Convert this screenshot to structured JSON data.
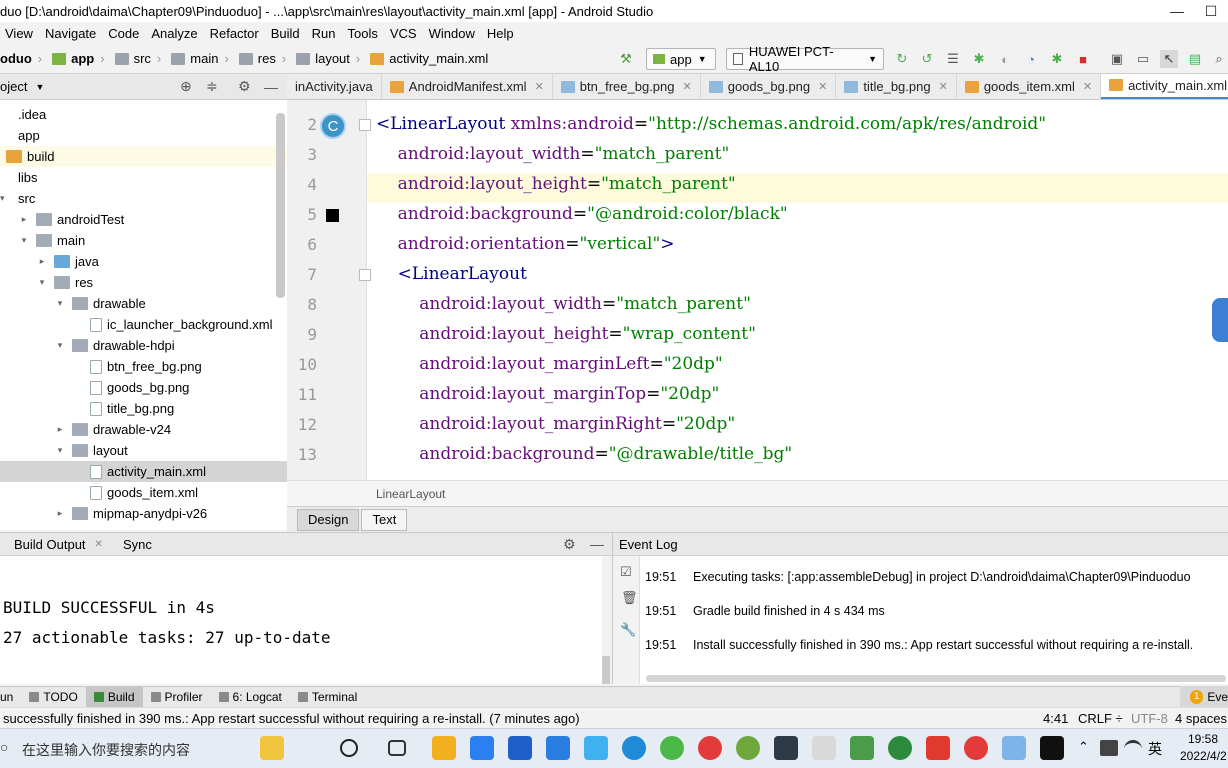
{
  "window": {
    "title": "duo [D:\\android\\daima\\Chapter09\\Pinduoduo] - ...\\app\\src\\main\\res\\layout\\activity_main.xml [app] - Android Studio",
    "minimize": "—",
    "maximize": "☐",
    "close": "✕"
  },
  "menu": {
    "items": [
      "View",
      "Navigate",
      "Code",
      "Analyze",
      "Refactor",
      "Build",
      "Run",
      "Tools",
      "VCS",
      "Window",
      "Help"
    ]
  },
  "breadcrumb": {
    "items": [
      "oduo",
      "app",
      "src",
      "main",
      "res",
      "layout",
      "activity_main.xml"
    ]
  },
  "toolbar": {
    "run_config": "app",
    "device": "HUAWEI PCT-AL10"
  },
  "project_panel": {
    "title": "oject",
    "tree": [
      {
        "label": ".idea",
        "depth": 0,
        "arrow": "",
        "kind": "folder"
      },
      {
        "label": "app",
        "depth": 0,
        "arrow": "",
        "kind": "folder"
      },
      {
        "label": "build",
        "depth": 0,
        "arrow": "",
        "kind": "folder-orange"
      },
      {
        "label": "libs",
        "depth": 0,
        "arrow": "",
        "kind": "folder"
      },
      {
        "label": "src",
        "depth": 0,
        "arrow": "▾",
        "kind": "folder"
      },
      {
        "label": "androidTest",
        "depth": 1,
        "arrow": "▸",
        "kind": "folder"
      },
      {
        "label": "main",
        "depth": 1,
        "arrow": "▾",
        "kind": "folder"
      },
      {
        "label": "java",
        "depth": 2,
        "arrow": "▸",
        "kind": "folder-blue"
      },
      {
        "label": "res",
        "depth": 2,
        "arrow": "▾",
        "kind": "folder"
      },
      {
        "label": "drawable",
        "depth": 3,
        "arrow": "▾",
        "kind": "folder"
      },
      {
        "label": "ic_launcher_background.xml",
        "depth": 4,
        "arrow": "",
        "kind": "file"
      },
      {
        "label": "drawable-hdpi",
        "depth": 3,
        "arrow": "▾",
        "kind": "folder"
      },
      {
        "label": "btn_free_bg.png",
        "depth": 4,
        "arrow": "",
        "kind": "file"
      },
      {
        "label": "goods_bg.png",
        "depth": 4,
        "arrow": "",
        "kind": "file"
      },
      {
        "label": "title_bg.png",
        "depth": 4,
        "arrow": "",
        "kind": "file"
      },
      {
        "label": "drawable-v24",
        "depth": 3,
        "arrow": "▸",
        "kind": "folder"
      },
      {
        "label": "layout",
        "depth": 3,
        "arrow": "▾",
        "kind": "folder"
      },
      {
        "label": "activity_main.xml",
        "depth": 4,
        "arrow": "",
        "kind": "file",
        "selected": true
      },
      {
        "label": "goods_item.xml",
        "depth": 4,
        "arrow": "",
        "kind": "file"
      },
      {
        "label": "mipmap-anydpi-v26",
        "depth": 3,
        "arrow": "▸",
        "kind": "folder"
      }
    ]
  },
  "editor_tabs": [
    {
      "label": "inActivity.java",
      "active": false
    },
    {
      "label": "AndroidManifest.xml",
      "active": false
    },
    {
      "label": "btn_free_bg.png",
      "active": false
    },
    {
      "label": "goods_bg.png",
      "active": false
    },
    {
      "label": "title_bg.png",
      "active": false
    },
    {
      "label": "goods_item.xml",
      "active": false
    },
    {
      "label": "activity_main.xml",
      "active": true
    }
  ],
  "editor": {
    "lines": [
      {
        "n": "2",
        "parts": [
          [
            "t",
            "<LinearLayout "
          ],
          [
            "a",
            "xmlns:android"
          ],
          [
            "p",
            "="
          ],
          [
            "v",
            "\"http://schemas.android.com/apk/res/android\""
          ]
        ]
      },
      {
        "n": "3",
        "parts": [
          [
            "p",
            "    "
          ],
          [
            "a",
            "android:layout_width"
          ],
          [
            "p",
            "="
          ],
          [
            "v",
            "\"match_parent\""
          ]
        ]
      },
      {
        "n": "4",
        "parts": [
          [
            "p",
            "    "
          ],
          [
            "a",
            "android:layout_height"
          ],
          [
            "p",
            "="
          ],
          [
            "v",
            "\"match_parent\""
          ]
        ]
      },
      {
        "n": "5",
        "parts": [
          [
            "p",
            "    "
          ],
          [
            "a",
            "android:background"
          ],
          [
            "p",
            "="
          ],
          [
            "v",
            "\"@android:color/black\""
          ]
        ]
      },
      {
        "n": "6",
        "parts": [
          [
            "p",
            "    "
          ],
          [
            "a",
            "android:orientation"
          ],
          [
            "p",
            "="
          ],
          [
            "v",
            "\"vertical\""
          ],
          [
            "t",
            ">"
          ]
        ]
      },
      {
        "n": "7",
        "parts": [
          [
            "p",
            "    "
          ],
          [
            "t",
            "<LinearLayout"
          ]
        ]
      },
      {
        "n": "8",
        "parts": [
          [
            "p",
            "        "
          ],
          [
            "a",
            "android:layout_width"
          ],
          [
            "p",
            "="
          ],
          [
            "v",
            "\"match_parent\""
          ]
        ]
      },
      {
        "n": "9",
        "parts": [
          [
            "p",
            "        "
          ],
          [
            "a",
            "android:layout_height"
          ],
          [
            "p",
            "="
          ],
          [
            "v",
            "\"wrap_content\""
          ]
        ]
      },
      {
        "n": "10",
        "parts": [
          [
            "p",
            "        "
          ],
          [
            "a",
            "android:layout_marginLeft"
          ],
          [
            "p",
            "="
          ],
          [
            "v",
            "\"20dp\""
          ]
        ]
      },
      {
        "n": "11",
        "parts": [
          [
            "p",
            "        "
          ],
          [
            "a",
            "android:layout_marginTop"
          ],
          [
            "p",
            "="
          ],
          [
            "v",
            "\"20dp\""
          ]
        ]
      },
      {
        "n": "12",
        "parts": [
          [
            "p",
            "        "
          ],
          [
            "a",
            "android:layout_marginRight"
          ],
          [
            "p",
            "="
          ],
          [
            "v",
            "\"20dp\""
          ]
        ]
      },
      {
        "n": "13",
        "parts": [
          [
            "p",
            "        "
          ],
          [
            "a",
            "android:background"
          ],
          [
            "p",
            "="
          ],
          [
            "v",
            "\"@drawable/title_bg\""
          ]
        ]
      }
    ],
    "class_badge": "C",
    "structure_crumb": "LinearLayout"
  },
  "design_tabs": [
    "Design",
    "Text"
  ],
  "build_panel": {
    "tabs": [
      "Build Output",
      "Sync"
    ],
    "lines": [
      "BUILD SUCCESSFUL in 4s",
      "27 actionable tasks: 27 up-to-date"
    ]
  },
  "event_log": {
    "title": "Event Log",
    "entries": [
      {
        "time": "19:51",
        "text": "Executing tasks: [:app:assembleDebug] in project D:\\android\\daima\\Chapter09\\Pinduoduo"
      },
      {
        "time": "19:51",
        "text": "Gradle build finished in 4 s 434 ms"
      },
      {
        "time": "19:51",
        "text": "Install successfully finished in 390 ms.: App restart successful without requiring a re-install."
      }
    ]
  },
  "tool_windows": [
    "un",
    "TODO",
    "Build",
    "Profiler",
    "6: Logcat",
    "Terminal"
  ],
  "event_badge": "1",
  "event_short": "Eve",
  "status_bar": {
    "message": "successfully finished in 390 ms.: App restart successful without requiring a re-install. (7 minutes ago)",
    "position": "4:41",
    "line_sep": "CRLF ÷",
    "encoding": "UTF-8",
    "indent": "4 spaces"
  },
  "taskbar": {
    "search_placeholder": "在这里输入你要搜索的内容",
    "ime": "英",
    "time": "19:58",
    "date": "2022/4/2"
  }
}
